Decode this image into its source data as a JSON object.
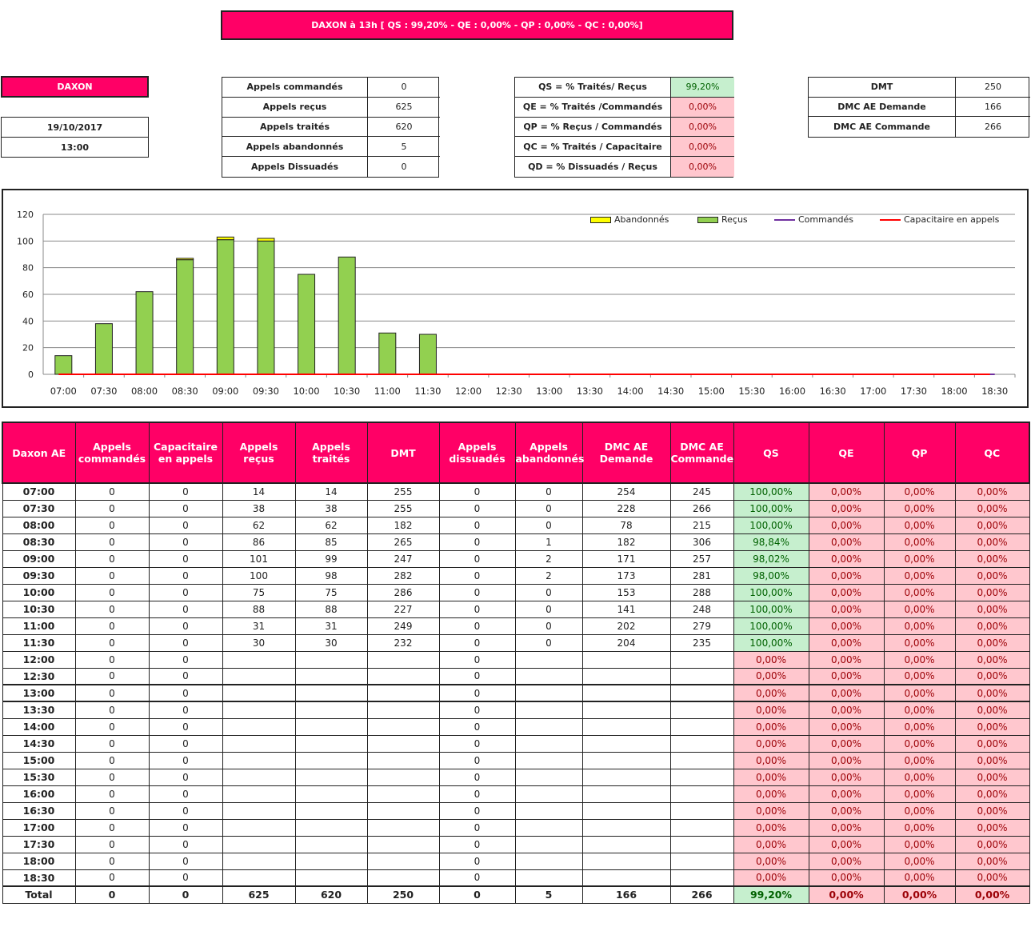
{
  "banner": "DAXON à 13h [ QS : 99,20% - QE : 0,00% - QP : 0,00% - QC : 0,00%]",
  "site": {
    "name": "DAXON",
    "date": "19/10/2017",
    "hour": "13:00"
  },
  "calls_box": [
    {
      "label": "Appels commandés",
      "value": "0"
    },
    {
      "label": "Appels reçus",
      "value": "625"
    },
    {
      "label": "Appels traités",
      "value": "620"
    },
    {
      "label": "Appels abandonnés",
      "value": "5"
    },
    {
      "label": "Appels Dissuadés",
      "value": "0"
    }
  ],
  "ratio_box": [
    {
      "label": "QS = % Traités/ Reçus",
      "value": "99,20%",
      "status": "good"
    },
    {
      "label": "QE = % Traités /Commandés",
      "value": "0,00%",
      "status": "bad"
    },
    {
      "label": "QP = % Reçus / Commandés",
      "value": "0,00%",
      "status": "bad"
    },
    {
      "label": "QC = % Traités / Capacitaire",
      "value": "0,00%",
      "status": "bad"
    },
    {
      "label": "QD = % Dissuadés / Reçus",
      "value": "0,00%",
      "status": "bad"
    }
  ],
  "dm_box": [
    {
      "label": "DMT",
      "value": "250"
    },
    {
      "label": "DMC AE Demande",
      "value": "166"
    },
    {
      "label": "DMC AE Commande",
      "value": "266"
    }
  ],
  "chart_data": {
    "type": "bar",
    "categories": [
      "07:00",
      "07:30",
      "08:00",
      "08:30",
      "09:00",
      "09:30",
      "10:00",
      "10:30",
      "11:00",
      "11:30",
      "12:00",
      "12:30",
      "13:00",
      "13:30",
      "14:00",
      "14:30",
      "15:00",
      "15:30",
      "16:00",
      "16:30",
      "17:00",
      "17:30",
      "18:00",
      "18:30"
    ],
    "series": [
      {
        "name": "Abandonnés",
        "kind": "stacked-bar",
        "color": "#ffff00",
        "values": [
          0,
          0,
          0,
          1,
          2,
          2,
          0,
          0,
          0,
          0,
          0,
          0,
          0,
          0,
          0,
          0,
          0,
          0,
          0,
          0,
          0,
          0,
          0,
          0
        ]
      },
      {
        "name": "Reçus",
        "kind": "stacked-bar",
        "color": "#92d050",
        "values": [
          14,
          38,
          62,
          86,
          101,
          100,
          75,
          88,
          31,
          30,
          0,
          0,
          0,
          0,
          0,
          0,
          0,
          0,
          0,
          0,
          0,
          0,
          0,
          0
        ]
      },
      {
        "name": "Commandés",
        "kind": "line",
        "color": "#7030a0",
        "values": [
          0,
          0,
          0,
          0,
          0,
          0,
          0,
          0,
          0,
          0,
          0,
          0,
          0,
          0,
          0,
          0,
          0,
          0,
          0,
          0,
          0,
          0,
          0,
          0
        ]
      },
      {
        "name": "Capacitaire en appels",
        "kind": "line",
        "color": "#ff0000",
        "values": [
          0,
          0,
          0,
          0,
          0,
          0,
          0,
          0,
          0,
          0,
          0,
          0,
          0,
          0,
          0,
          0,
          0,
          0,
          0,
          0,
          0,
          0,
          0,
          0
        ]
      }
    ],
    "yticks": [
      "0",
      "20",
      "40",
      "60",
      "80",
      "100",
      "120"
    ],
    "ylim": [
      0,
      120
    ],
    "grid": true,
    "legend_position": "top-right"
  },
  "table": {
    "headers": [
      "Daxon AE",
      "Appels commandés",
      "Capacitaire en appels",
      "Appels reçus",
      "Appels traités",
      "DMT",
      "Appels dissuadés",
      "Appels abandonnés",
      "DMC AE Demande",
      "DMC AE Commande",
      "QS",
      "QE",
      "QP",
      "QC"
    ],
    "rows": [
      [
        "07:00",
        "0",
        "0",
        "14",
        "14",
        "255",
        "0",
        "0",
        "254",
        "245",
        "100,00%",
        "0,00%",
        "0,00%",
        "0,00%"
      ],
      [
        "07:30",
        "0",
        "0",
        "38",
        "38",
        "255",
        "0",
        "0",
        "228",
        "266",
        "100,00%",
        "0,00%",
        "0,00%",
        "0,00%"
      ],
      [
        "08:00",
        "0",
        "0",
        "62",
        "62",
        "182",
        "0",
        "0",
        "78",
        "215",
        "100,00%",
        "0,00%",
        "0,00%",
        "0,00%"
      ],
      [
        "08:30",
        "0",
        "0",
        "86",
        "85",
        "265",
        "0",
        "1",
        "182",
        "306",
        "98,84%",
        "0,00%",
        "0,00%",
        "0,00%"
      ],
      [
        "09:00",
        "0",
        "0",
        "101",
        "99",
        "247",
        "0",
        "2",
        "171",
        "257",
        "98,02%",
        "0,00%",
        "0,00%",
        "0,00%"
      ],
      [
        "09:30",
        "0",
        "0",
        "100",
        "98",
        "282",
        "0",
        "2",
        "173",
        "281",
        "98,00%",
        "0,00%",
        "0,00%",
        "0,00%"
      ],
      [
        "10:00",
        "0",
        "0",
        "75",
        "75",
        "286",
        "0",
        "0",
        "153",
        "288",
        "100,00%",
        "0,00%",
        "0,00%",
        "0,00%"
      ],
      [
        "10:30",
        "0",
        "0",
        "88",
        "88",
        "227",
        "0",
        "0",
        "141",
        "248",
        "100,00%",
        "0,00%",
        "0,00%",
        "0,00%"
      ],
      [
        "11:00",
        "0",
        "0",
        "31",
        "31",
        "249",
        "0",
        "0",
        "202",
        "279",
        "100,00%",
        "0,00%",
        "0,00%",
        "0,00%"
      ],
      [
        "11:30",
        "0",
        "0",
        "30",
        "30",
        "232",
        "0",
        "0",
        "204",
        "235",
        "100,00%",
        "0,00%",
        "0,00%",
        "0,00%"
      ],
      [
        "12:00",
        "0",
        "0",
        "",
        "",
        "",
        "0",
        "",
        "",
        "",
        "0,00%",
        "0,00%",
        "0,00%",
        "0,00%"
      ],
      [
        "12:30",
        "0",
        "0",
        "",
        "",
        "",
        "0",
        "",
        "",
        "",
        "0,00%",
        "0,00%",
        "0,00%",
        "0,00%"
      ],
      [
        "13:00",
        "0",
        "0",
        "",
        "",
        "",
        "0",
        "",
        "",
        "",
        "0,00%",
        "0,00%",
        "0,00%",
        "0,00%"
      ],
      [
        "13:30",
        "0",
        "0",
        "",
        "",
        "",
        "0",
        "",
        "",
        "",
        "0,00%",
        "0,00%",
        "0,00%",
        "0,00%"
      ],
      [
        "14:00",
        "0",
        "0",
        "",
        "",
        "",
        "0",
        "",
        "",
        "",
        "0,00%",
        "0,00%",
        "0,00%",
        "0,00%"
      ],
      [
        "14:30",
        "0",
        "0",
        "",
        "",
        "",
        "0",
        "",
        "",
        "",
        "0,00%",
        "0,00%",
        "0,00%",
        "0,00%"
      ],
      [
        "15:00",
        "0",
        "0",
        "",
        "",
        "",
        "0",
        "",
        "",
        "",
        "0,00%",
        "0,00%",
        "0,00%",
        "0,00%"
      ],
      [
        "15:30",
        "0",
        "0",
        "",
        "",
        "",
        "0",
        "",
        "",
        "",
        "0,00%",
        "0,00%",
        "0,00%",
        "0,00%"
      ],
      [
        "16:00",
        "0",
        "0",
        "",
        "",
        "",
        "0",
        "",
        "",
        "",
        "0,00%",
        "0,00%",
        "0,00%",
        "0,00%"
      ],
      [
        "16:30",
        "0",
        "0",
        "",
        "",
        "",
        "0",
        "",
        "",
        "",
        "0,00%",
        "0,00%",
        "0,00%",
        "0,00%"
      ],
      [
        "17:00",
        "0",
        "0",
        "",
        "",
        "",
        "0",
        "",
        "",
        "",
        "0,00%",
        "0,00%",
        "0,00%",
        "0,00%"
      ],
      [
        "17:30",
        "0",
        "0",
        "",
        "",
        "",
        "0",
        "",
        "",
        "",
        "0,00%",
        "0,00%",
        "0,00%",
        "0,00%"
      ],
      [
        "18:00",
        "0",
        "0",
        "",
        "",
        "",
        "0",
        "",
        "",
        "",
        "0,00%",
        "0,00%",
        "0,00%",
        "0,00%"
      ],
      [
        "18:30",
        "0",
        "0",
        "",
        "",
        "",
        "0",
        "",
        "",
        "",
        "0,00%",
        "0,00%",
        "0,00%",
        "0,00%"
      ]
    ],
    "total": [
      "Total",
      "0",
      "0",
      "625",
      "620",
      "250",
      "0",
      "5",
      "166",
      "266",
      "99,20%",
      "0,00%",
      "0,00%",
      "0,00%"
    ]
  },
  "colors": {
    "accent": "#ff0066",
    "good_bg": "#c6efce",
    "good_text": "#006100",
    "bad_bg": "#ffc7ce",
    "bad_text": "#9c0006"
  }
}
